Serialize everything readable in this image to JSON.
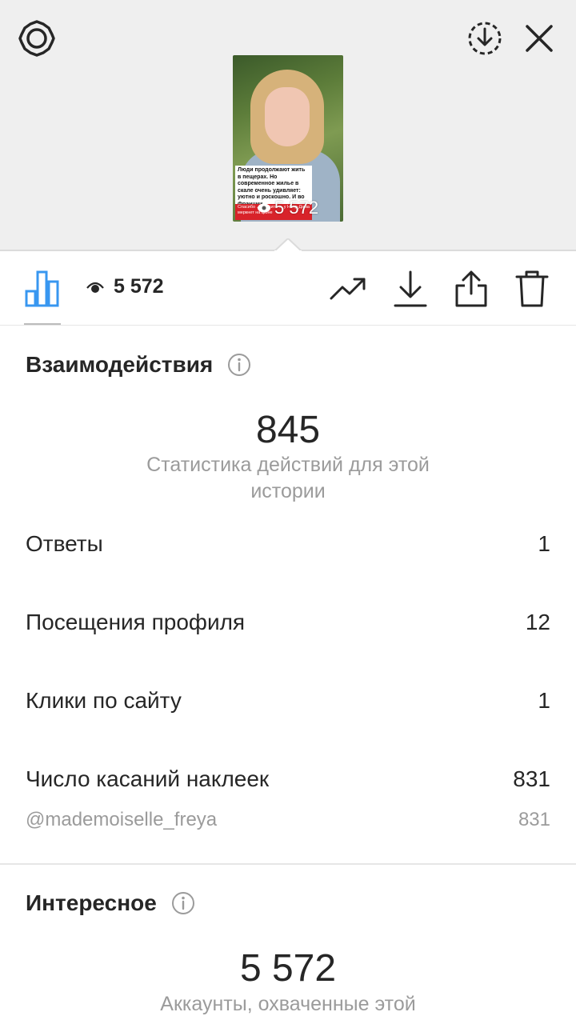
{
  "header": {
    "settings_icon": "gear-icon",
    "download_icon": "download-circle-icon",
    "close_icon": "close-icon"
  },
  "story": {
    "caption_text": "Люди продолжают жить в пещерах. Но современное жилье в скале очень удивляет: уютно и роскошно. И во Франции",
    "red_text": "Спасибо ... просите ... у Нотр-Дама меркнет на фоне",
    "views": "5 572"
  },
  "toolbar": {
    "stats_icon": "bar-chart-icon",
    "eye_icon": "eye-icon",
    "views": "5 572",
    "trend_icon": "trending-up-icon",
    "save_icon": "download-icon",
    "share_icon": "share-icon",
    "delete_icon": "trash-icon"
  },
  "interactions": {
    "title": "Взаимодействия",
    "total": "845",
    "subtitle": "Статистика действий для этой истории",
    "rows": [
      {
        "label": "Ответы",
        "value": "1"
      },
      {
        "label": "Посещения профиля",
        "value": "12"
      },
      {
        "label": "Клики по сайту",
        "value": "1"
      },
      {
        "label": "Число касаний наклеек",
        "value": "831"
      }
    ],
    "sub_row": {
      "label": "@mademoiselle_freya",
      "value": "831"
    }
  },
  "discovery": {
    "title": "Интересное",
    "total": "5 572",
    "subtitle": "Аккаунты, охваченные этой"
  },
  "colors": {
    "accent_blue": "#3897f0",
    "text": "#262626",
    "secondary": "#9b9b9b"
  }
}
